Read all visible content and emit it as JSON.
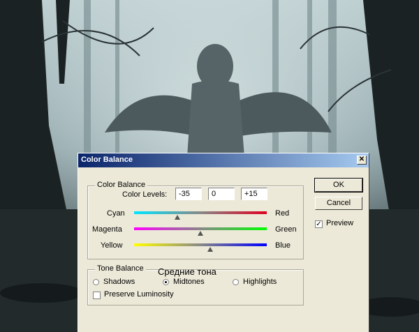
{
  "dialog": {
    "title": "Color Balance",
    "close_label": "✕",
    "color_balance": {
      "group_title": "Color Balance",
      "levels_label": "Color Levels:",
      "levels": [
        "-35",
        "0",
        "+15"
      ],
      "sliders": [
        {
          "left": "Cyan",
          "right": "Red",
          "value": -35,
          "gradient": [
            "#00e5ff",
            "#e00020"
          ]
        },
        {
          "left": "Magenta",
          "right": "Green",
          "value": 0,
          "gradient": [
            "#ff00ff",
            "#00ff00"
          ]
        },
        {
          "left": "Yellow",
          "right": "Blue",
          "value": 15,
          "gradient": [
            "#ffff00",
            "#0000ff"
          ]
        }
      ]
    },
    "tone_balance": {
      "group_title": "Tone Balance",
      "shadows": "Shadows",
      "midtones": "Midtones",
      "highlights": "Highlights",
      "selected": "Midtones",
      "preserve_luminosity": "Preserve Luminosity",
      "preserve_checked": false
    },
    "buttons": {
      "ok": "OK",
      "cancel": "Cancel"
    },
    "preview": {
      "label": "Preview",
      "checked": true
    }
  },
  "annotation": "Средние тона"
}
